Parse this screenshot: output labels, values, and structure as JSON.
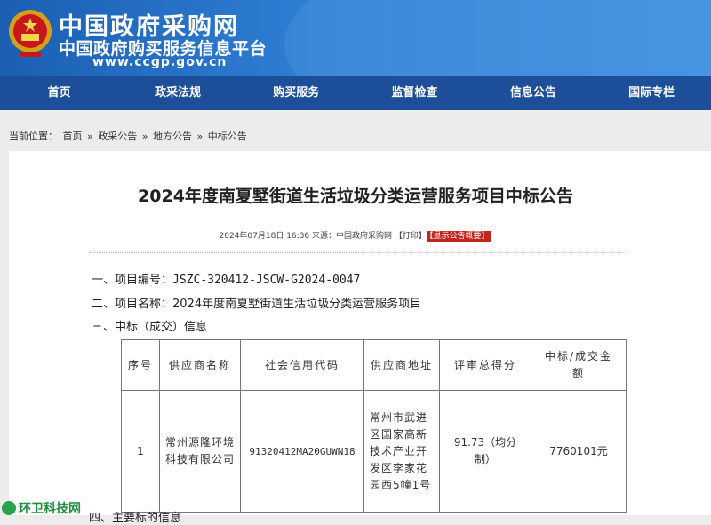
{
  "header": {
    "site_name": "中国政府采购网",
    "site_subtitle": "中国政府购买服务信息平台",
    "site_url": "www.ccgp.gov.cn"
  },
  "nav": {
    "items": [
      "首页",
      "政采法规",
      "购买服务",
      "监督检查",
      "信息公告",
      "国际专栏"
    ]
  },
  "breadcrumb": {
    "label": "当前位置：",
    "items": [
      "首页",
      "»",
      "政采公告",
      "»",
      "地方公告",
      "»",
      "中标公告"
    ]
  },
  "article": {
    "title": "2024年度南夏墅街道生活垃圾分类运营服务项目中标公告",
    "meta_date": "2024年07月18日 16:36",
    "meta_source": "来源：",
    "meta_source_name": "中国政府采购网",
    "meta_print": "【打印】",
    "meta_summary": "【显示公告概要】",
    "line1_label": "一、项目编号：",
    "line1_value": "JSZC-320412-JSCW-G2024-0047",
    "line2": "二、项目名称：2024年度南夏墅街道生活垃圾分类运营服务项目",
    "line3": "三、中标（成交）信息",
    "line4_partial": "四、主要标的信息"
  },
  "table": {
    "headers": [
      "序号",
      "供应商名称",
      "社会信用代码",
      "供应商地址",
      "评审总得分",
      "中标/成交金额"
    ],
    "row": {
      "index": "1",
      "supplier": "常州源隆环境科技有限公司",
      "credit_code": "91320412MA20GUWN18",
      "address": "常州市武进区国家高新技术产业开发区李家花园西5幢1号",
      "score": "91.73（均分制）",
      "amount": "7760101元"
    }
  },
  "watermark": {
    "text": "环卫科技网"
  },
  "colors": {
    "nav": "#1d4e9a",
    "header": "#2f7fd6",
    "badge": "#c4261d"
  }
}
